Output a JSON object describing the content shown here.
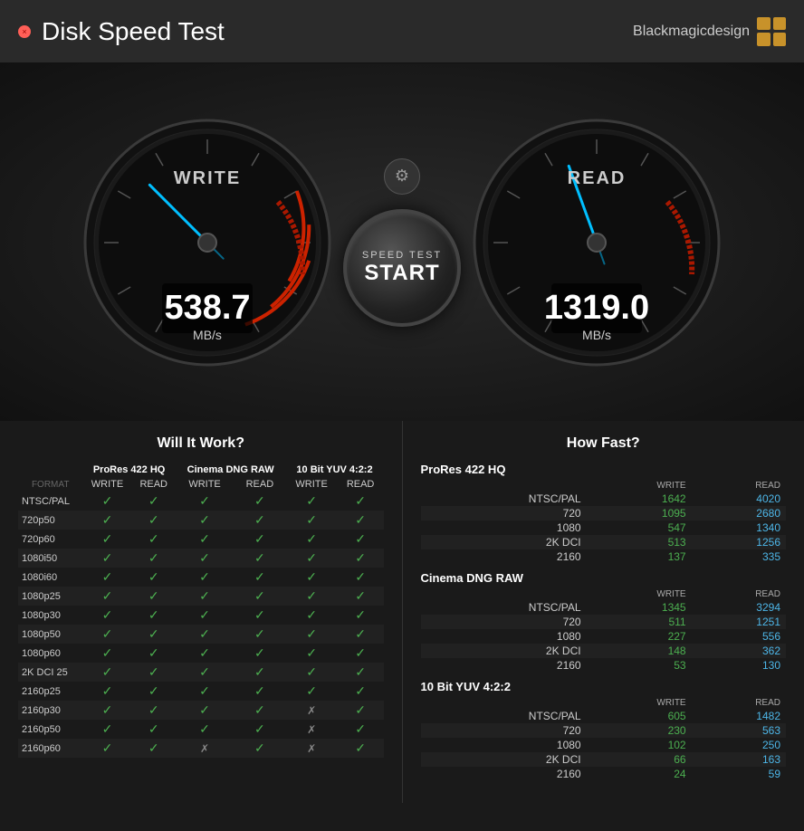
{
  "titleBar": {
    "closeBtn": "×",
    "title": "Disk Speed Test",
    "brand": "Blackmagicdesign"
  },
  "writeGauge": {
    "label": "WRITE",
    "value": "538.7",
    "unit": "MB/s",
    "needleAngle": -45
  },
  "readGauge": {
    "label": "READ",
    "value": "1319.0",
    "unit": "MB/s",
    "needleAngle": -20
  },
  "settingsBtn": "⚙",
  "startBtn": {
    "sub": "SPEED TEST",
    "main": "START"
  },
  "willItWork": {
    "title": "Will It Work?",
    "columnGroups": [
      "ProRes 422 HQ",
      "Cinema DNG RAW",
      "10 Bit YUV 4:2:2"
    ],
    "subHeaders": [
      "WRITE",
      "READ"
    ],
    "formatLabel": "FORMAT",
    "rows": [
      {
        "format": "NTSC/PAL",
        "cols": [
          "✓",
          "✓",
          "✓",
          "✓",
          "✓",
          "✓"
        ]
      },
      {
        "format": "720p50",
        "cols": [
          "✓",
          "✓",
          "✓",
          "✓",
          "✓",
          "✓"
        ]
      },
      {
        "format": "720p60",
        "cols": [
          "✓",
          "✓",
          "✓",
          "✓",
          "✓",
          "✓"
        ]
      },
      {
        "format": "1080i50",
        "cols": [
          "✓",
          "✓",
          "✓",
          "✓",
          "✓",
          "✓"
        ]
      },
      {
        "format": "1080i60",
        "cols": [
          "✓",
          "✓",
          "✓",
          "✓",
          "✓",
          "✓"
        ]
      },
      {
        "format": "1080p25",
        "cols": [
          "✓",
          "✓",
          "✓",
          "✓",
          "✓",
          "✓"
        ]
      },
      {
        "format": "1080p30",
        "cols": [
          "✓",
          "✓",
          "✓",
          "✓",
          "✓",
          "✓"
        ]
      },
      {
        "format": "1080p50",
        "cols": [
          "✓",
          "✓",
          "✓",
          "✓",
          "✓",
          "✓"
        ]
      },
      {
        "format": "1080p60",
        "cols": [
          "✓",
          "✓",
          "✓",
          "✓",
          "✓",
          "✓"
        ]
      },
      {
        "format": "2K DCI 25",
        "cols": [
          "✓",
          "✓",
          "✓",
          "✓",
          "✓",
          "✓"
        ]
      },
      {
        "format": "2160p25",
        "cols": [
          "✓",
          "✓",
          "✓",
          "✓",
          "✓",
          "✓"
        ]
      },
      {
        "format": "2160p30",
        "cols": [
          "✓",
          "✓",
          "✓",
          "✓",
          "✗",
          "✓"
        ]
      },
      {
        "format": "2160p50",
        "cols": [
          "✓",
          "✓",
          "✓",
          "✓",
          "✗",
          "✓"
        ]
      },
      {
        "format": "2160p60",
        "cols": [
          "✓",
          "✓",
          "✗",
          "✓",
          "✗",
          "✓"
        ]
      }
    ]
  },
  "howFast": {
    "title": "How Fast?",
    "groups": [
      {
        "title": "ProRes 422 HQ",
        "headers": [
          "",
          "WRITE",
          "READ"
        ],
        "rows": [
          {
            "label": "NTSC/PAL",
            "write": "1642",
            "read": "4020"
          },
          {
            "label": "720",
            "write": "1095",
            "read": "2680"
          },
          {
            "label": "1080",
            "write": "547",
            "read": "1340"
          },
          {
            "label": "2K DCI",
            "write": "513",
            "read": "1256"
          },
          {
            "label": "2160",
            "write": "137",
            "read": "335"
          }
        ]
      },
      {
        "title": "Cinema DNG RAW",
        "headers": [
          "",
          "WRITE",
          "READ"
        ],
        "rows": [
          {
            "label": "NTSC/PAL",
            "write": "1345",
            "read": "3294"
          },
          {
            "label": "720",
            "write": "511",
            "read": "1251"
          },
          {
            "label": "1080",
            "write": "227",
            "read": "556"
          },
          {
            "label": "2K DCI",
            "write": "148",
            "read": "362"
          },
          {
            "label": "2160",
            "write": "53",
            "read": "130"
          }
        ]
      },
      {
        "title": "10 Bit YUV 4:2:2",
        "headers": [
          "",
          "WRITE",
          "READ"
        ],
        "rows": [
          {
            "label": "NTSC/PAL",
            "write": "605",
            "read": "1482"
          },
          {
            "label": "720",
            "write": "230",
            "read": "563"
          },
          {
            "label": "1080",
            "write": "102",
            "read": "250"
          },
          {
            "label": "2K DCI",
            "write": "66",
            "read": "163"
          },
          {
            "label": "2160",
            "write": "24",
            "read": "59"
          }
        ]
      }
    ]
  }
}
